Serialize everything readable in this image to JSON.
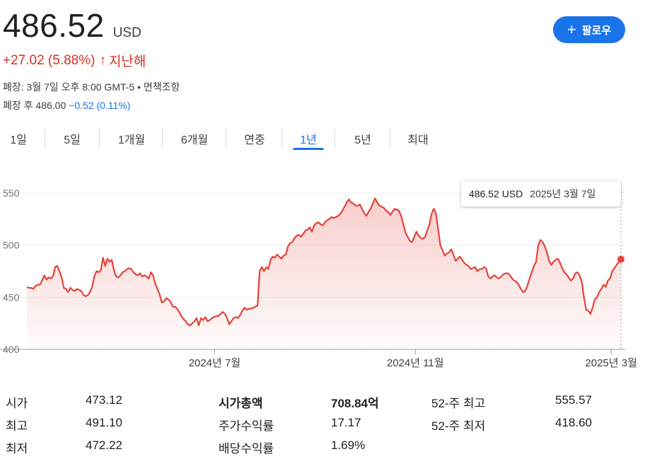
{
  "header": {
    "price": "486.52",
    "currency": "USD",
    "change": "+27.02 (5.88%)",
    "change_arrow": "↑",
    "period": "지난해",
    "close_info": "폐장: 3월 7일 오후 8:00 GMT-5 • 면책조항",
    "after_hours_label": "폐장 후 486.00",
    "after_hours_change": "−0.52 (0.11%)",
    "follow_label": "팔로우",
    "follow_icon": "+"
  },
  "tabs": [
    "1일",
    "5일",
    "1개월",
    "6개월",
    "연중",
    "1년",
    "5년",
    "최대"
  ],
  "active_tab": 5,
  "tooltip": {
    "value": "486.52 USD",
    "date": "2025년 3월 7일"
  },
  "stats": {
    "col1": [
      {
        "label": "시가",
        "value": "473.12"
      },
      {
        "label": "최고",
        "value": "491.10"
      },
      {
        "label": "최저",
        "value": "472.22"
      }
    ],
    "col2": [
      {
        "label": "시가총액",
        "value": "708.84억"
      },
      {
        "label": "주가수익률",
        "value": "17.17"
      },
      {
        "label": "배당수익률",
        "value": "1.69%"
      }
    ],
    "col3": [
      {
        "label": "52-주 최고",
        "value": "555.57"
      },
      {
        "label": "52-주 최저",
        "value": "418.60"
      }
    ]
  },
  "colors": {
    "line": "#e5423a",
    "accent": "#1a73e8",
    "negative": "#d93025"
  },
  "chart_data": {
    "type": "area",
    "ylim": [
      400,
      550
    ],
    "yticks": [
      400,
      450,
      500,
      550
    ],
    "xtick_labels": [
      {
        "label": "2024년 7월",
        "date": "2024-07-01"
      },
      {
        "label": "2024년 11월",
        "date": "2024-11-01"
      },
      {
        "label": "2025년 3월",
        "date": "2025-03-01"
      }
    ],
    "x_start": "2024-03-08",
    "x_end": "2025-03-07",
    "series": [
      {
        "values": [
          460,
          459,
          459,
          458,
          461,
          462,
          462,
          466,
          471,
          467,
          469,
          468,
          470,
          479,
          480,
          475,
          469,
          459,
          458,
          455,
          459,
          457,
          456,
          458,
          457,
          456,
          452,
          451,
          452,
          455,
          460,
          470,
          475,
          474,
          476,
          488,
          480,
          487,
          484,
          486,
          476,
          470,
          469,
          471,
          474,
          475,
          477,
          478,
          477,
          474,
          472,
          471,
          473,
          470,
          471,
          470,
          468,
          474,
          471,
          463,
          458,
          453,
          445,
          446,
          449,
          448,
          446,
          441,
          441,
          439,
          436,
          432,
          429,
          427,
          424,
          423,
          425,
          427,
          430,
          423,
          430,
          428,
          431,
          427,
          428,
          430,
          431,
          432,
          432,
          434,
          436,
          434,
          430,
          424,
          427,
          430,
          431,
          430,
          433,
          437,
          440,
          438,
          439,
          439,
          440,
          441,
          442,
          475,
          479,
          475,
          479,
          477,
          486,
          489,
          488,
          491,
          489,
          487,
          490,
          491,
          499,
          502,
          503,
          507,
          509,
          510,
          508,
          511,
          514,
          515,
          517,
          513,
          519,
          521,
          522,
          520,
          519,
          522,
          524,
          525,
          527,
          526,
          527,
          528,
          530,
          533,
          537,
          541,
          544,
          541,
          540,
          538,
          538,
          539,
          535,
          531,
          528,
          532,
          535,
          540,
          545,
          541,
          538,
          537,
          536,
          533,
          532,
          529,
          532,
          535,
          534,
          533,
          528,
          520,
          512,
          508,
          504,
          503,
          508,
          513,
          509,
          507,
          506,
          508,
          514,
          520,
          530,
          535,
          530,
          515,
          500,
          495,
          490,
          492,
          493,
          496,
          491,
          485,
          487,
          489,
          486,
          483,
          481,
          480,
          477,
          478,
          479,
          475,
          477,
          477,
          479,
          478,
          470,
          468,
          470,
          471,
          469,
          468,
          470,
          472,
          473,
          473,
          471,
          468,
          466,
          465,
          462,
          458,
          455,
          456,
          461,
          468,
          474,
          480,
          484,
          500,
          505,
          503,
          499,
          493,
          485,
          481,
          484,
          486,
          487,
          483,
          478,
          474,
          472,
          469,
          466,
          468,
          473,
          474,
          471,
          465,
          450,
          438,
          437,
          434,
          440,
          448,
          450,
          455,
          458,
          462,
          460,
          466,
          468,
          475,
          478,
          481,
          484,
          486.52
        ]
      }
    ]
  }
}
